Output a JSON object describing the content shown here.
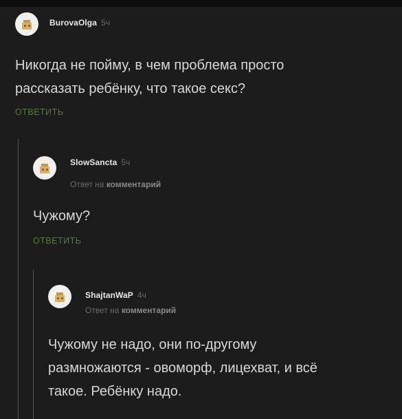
{
  "comments": [
    {
      "author": "BurovaOlga",
      "time": "5ч",
      "text_lines": [
        "Никогда не пойму, в чем проблема просто",
        "рассказать ребёнку, что такое секс?"
      ],
      "reply_label": "ОТВЕТИТЬ"
    },
    {
      "author": "SlowSancta",
      "time": "5ч",
      "reply_to_prefix": "Ответ на",
      "reply_to_link": "комментарий",
      "text_lines": [
        "Чужому?"
      ],
      "reply_label": "ОТВЕТИТЬ"
    },
    {
      "author": "ShajtanWaP",
      "time": "4ч",
      "reply_to_prefix": "Ответ на",
      "reply_to_link": "комментарий",
      "text_lines": [
        "Чужому не надо, они по-другому",
        "размножаются - овоморф, лицехват, и всё",
        "такое. Ребёнку надо."
      ]
    }
  ],
  "icons": {
    "avatar": "avatar-placeholder-icon"
  },
  "colors": {
    "background": "#1c1c1c",
    "reply_accent": "#4f7f3c",
    "thread_line": "#555555"
  }
}
